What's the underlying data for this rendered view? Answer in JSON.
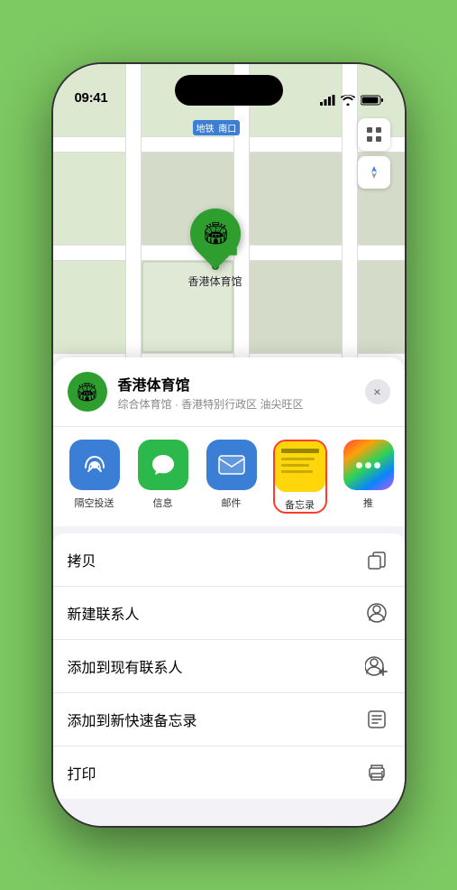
{
  "status_bar": {
    "time": "09:41",
    "location_icon": "▶"
  },
  "map": {
    "label_badge": "南口",
    "label_badge_prefix": "地铁",
    "marker_label": "香港体育馆",
    "controls": {
      "map_icon": "🗺",
      "location_icon": "➤"
    }
  },
  "location_card": {
    "name": "香港体育馆",
    "subtitle": "综合体育馆 · 香港特别行政区 油尖旺区",
    "close_label": "×"
  },
  "share_items": [
    {
      "id": "airdrop",
      "label": "隔空投送",
      "icon": "📡"
    },
    {
      "id": "messages",
      "label": "信息",
      "icon": "💬"
    },
    {
      "id": "mail",
      "label": "邮件",
      "icon": "✉"
    },
    {
      "id": "notes",
      "label": "备忘录",
      "icon": "📝"
    },
    {
      "id": "more",
      "label": "推",
      "icon": "···"
    }
  ],
  "actions": [
    {
      "id": "copy",
      "label": "拷贝",
      "icon": "copy"
    },
    {
      "id": "new-contact",
      "label": "新建联系人",
      "icon": "person"
    },
    {
      "id": "add-existing",
      "label": "添加到现有联系人",
      "icon": "person-add"
    },
    {
      "id": "quick-note",
      "label": "添加到新快速备忘录",
      "icon": "note"
    },
    {
      "id": "print",
      "label": "打印",
      "icon": "print"
    }
  ]
}
